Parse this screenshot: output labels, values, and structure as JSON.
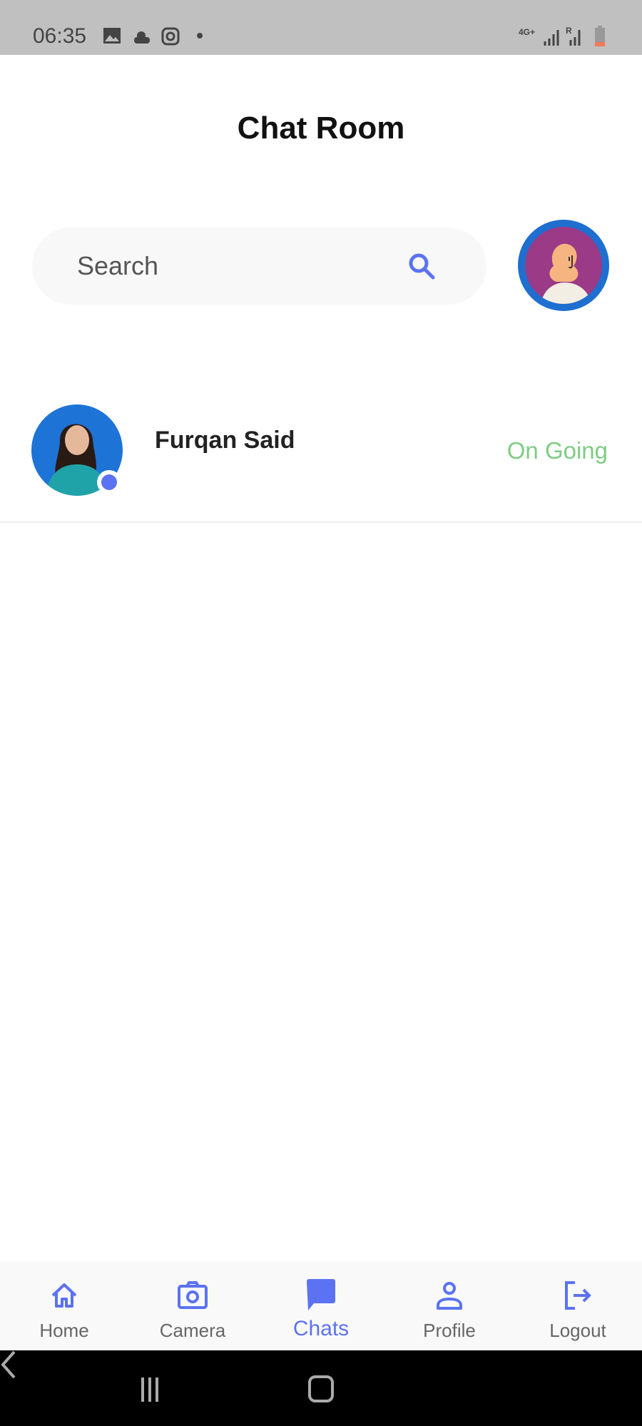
{
  "status_bar": {
    "time": "06:35",
    "network": "4G+",
    "roaming": "R"
  },
  "header": {
    "title": "Chat Room"
  },
  "search": {
    "placeholder": "Search"
  },
  "chats": [
    {
      "name": "Furqan Said",
      "status": "On Going"
    }
  ],
  "nav": {
    "items": [
      {
        "label": "Home"
      },
      {
        "label": "Camera"
      },
      {
        "label": "Chats"
      },
      {
        "label": "Profile"
      },
      {
        "label": "Logout"
      }
    ],
    "active": "Chats"
  },
  "colors": {
    "accent": "#5b72f2",
    "ongoing": "#7fcc84"
  }
}
